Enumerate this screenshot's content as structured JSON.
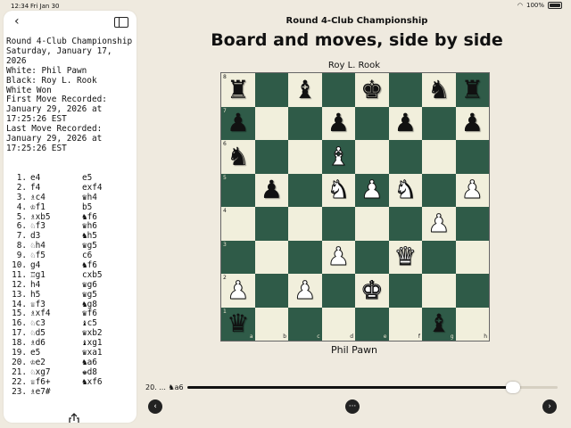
{
  "status_bar": {
    "time": "12:34",
    "date": "Fri Jan 30",
    "battery": "100%"
  },
  "sidebar": {
    "back_icon": "chevron-left-icon",
    "toggle_icon": "sidebar-icon",
    "share_icon": "share-icon",
    "metadata_lines": [
      "Round 4-Club Championship",
      "Saturday, January 17,",
      "2026",
      "White: Phil Pawn",
      "Black: Roy L. Rook",
      "White Won",
      "First Move Recorded:",
      "January 29, 2026 at",
      "17:25:26 EST",
      "Last Move Recorded:",
      "January 29, 2026 at",
      "17:25:26 EST"
    ],
    "moves": [
      {
        "num": "1.",
        "white": "e4",
        "black": "e5"
      },
      {
        "num": "2.",
        "white": "f4",
        "black": "exf4"
      },
      {
        "num": "3.",
        "white": "♗c4",
        "black": "♛h4"
      },
      {
        "num": "4.",
        "white": "♔f1",
        "black": "b5"
      },
      {
        "num": "5.",
        "white": "♗xb5",
        "black": "♞f6"
      },
      {
        "num": "6.",
        "white": "♘f3",
        "black": "♛h6"
      },
      {
        "num": "7.",
        "white": "d3",
        "black": "♞h5"
      },
      {
        "num": "8.",
        "white": "♘h4",
        "black": "♛g5"
      },
      {
        "num": "9.",
        "white": "♘f5",
        "black": "c6"
      },
      {
        "num": "10.",
        "white": "g4",
        "black": "♞f6"
      },
      {
        "num": "11.",
        "white": "♖g1",
        "black": "cxb5"
      },
      {
        "num": "12.",
        "white": "h4",
        "black": "♛g6"
      },
      {
        "num": "13.",
        "white": "h5",
        "black": "♛g5"
      },
      {
        "num": "14.",
        "white": "♕f3",
        "black": "♞g8"
      },
      {
        "num": "15.",
        "white": "♗xf4",
        "black": "♛f6"
      },
      {
        "num": "16.",
        "white": "♘c3",
        "black": "♝c5"
      },
      {
        "num": "17.",
        "white": "♘d5",
        "black": "♛xb2"
      },
      {
        "num": "18.",
        "white": "♗d6",
        "black": "♝xg1"
      },
      {
        "num": "19.",
        "white": "e5",
        "black": "♛xa1"
      },
      {
        "num": "20.",
        "white": "♔e2",
        "black": "♞a6"
      },
      {
        "num": "21.",
        "white": "♘xg7",
        "black": "♚d8"
      },
      {
        "num": "22.",
        "white": "♕f6+",
        "black": "♞xf6"
      },
      {
        "num": "23.",
        "white": "♗e7#",
        "black": ""
      }
    ]
  },
  "main": {
    "event": "Round 4-Club Championship",
    "title": "Board and moves, side by side",
    "black_player": "Roy L. Rook",
    "white_player": "Phil Pawn"
  },
  "board": {
    "light_color": "#f1efdc",
    "dark_color": "#2f5b48",
    "ranks": [
      [
        "bR",
        "",
        "bB",
        "",
        "bK",
        "",
        "bN",
        "bR"
      ],
      [
        "bP",
        "",
        "",
        "bP",
        "",
        "bP",
        "",
        "bP"
      ],
      [
        "bN",
        "",
        "",
        "wB",
        "",
        "",
        "",
        ""
      ],
      [
        "",
        "bP",
        "",
        "wN",
        "wP",
        "wN",
        "",
        "wP"
      ],
      [
        "",
        "",
        "",
        "",
        "",
        "",
        "wP",
        ""
      ],
      [
        "",
        "",
        "",
        "wP",
        "",
        "wQ",
        "",
        ""
      ],
      [
        "wP",
        "",
        "wP",
        "",
        "wK",
        "",
        "",
        ""
      ],
      [
        "bQ",
        "",
        "",
        "",
        "",
        "",
        "bB",
        ""
      ]
    ],
    "rank_labels": [
      "8",
      "7",
      "6",
      "5",
      "4",
      "3",
      "2",
      "1"
    ],
    "file_labels": [
      "a",
      "b",
      "c",
      "d",
      "e",
      "f",
      "g",
      "h"
    ]
  },
  "controls": {
    "current_move": "20. ... ♞a6",
    "progress": 0.88,
    "prev_icon": "chevron-left-icon",
    "menu_icon": "ellipsis-icon",
    "next_icon": "chevron-right-icon"
  }
}
